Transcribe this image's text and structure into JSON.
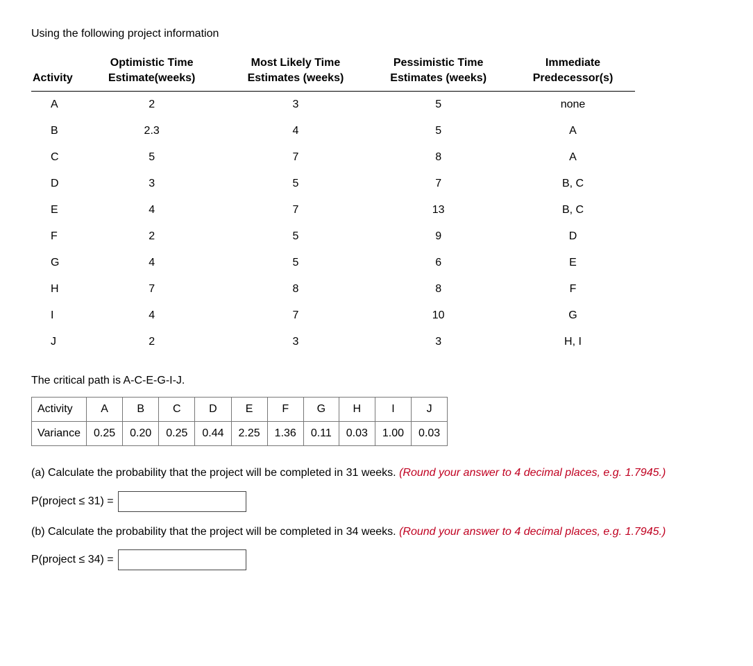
{
  "intro": "Using the following project information",
  "table_headers": {
    "activity": "Activity",
    "optimistic": "Optimistic Time Estimate(weeks)",
    "most_likely": "Most Likely Time Estimates (weeks)",
    "pessimistic": "Pessimistic Time Estimates (weeks)",
    "predecessor": "Immediate Predecessor(s)"
  },
  "rows": [
    {
      "act": "A",
      "opt": "2",
      "ml": "3",
      "pes": "5",
      "pred": "none"
    },
    {
      "act": "B",
      "opt": "2.3",
      "ml": "4",
      "pes": "5",
      "pred": "A"
    },
    {
      "act": "C",
      "opt": "5",
      "ml": "7",
      "pes": "8",
      "pred": "A"
    },
    {
      "act": "D",
      "opt": "3",
      "ml": "5",
      "pes": "7",
      "pred": "B, C"
    },
    {
      "act": "E",
      "opt": "4",
      "ml": "7",
      "pes": "13",
      "pred": "B, C"
    },
    {
      "act": "F",
      "opt": "2",
      "ml": "5",
      "pes": "9",
      "pred": "D"
    },
    {
      "act": "G",
      "opt": "4",
      "ml": "5",
      "pes": "6",
      "pred": "E"
    },
    {
      "act": "H",
      "opt": "7",
      "ml": "8",
      "pes": "8",
      "pred": "F"
    },
    {
      "act": "I",
      "opt": "4",
      "ml": "7",
      "pes": "10",
      "pred": "G"
    },
    {
      "act": "J",
      "opt": "2",
      "ml": "3",
      "pes": "3",
      "pred": "H, I"
    }
  ],
  "critical_path": "The critical path is A-C-E-G-I-J.",
  "variance_table": {
    "row_label_activity": "Activity",
    "row_label_variance": "Variance",
    "cols": [
      "A",
      "B",
      "C",
      "D",
      "E",
      "F",
      "G",
      "H",
      "I",
      "J"
    ],
    "vars": [
      "0.25",
      "0.20",
      "0.25",
      "0.44",
      "2.25",
      "1.36",
      "0.11",
      "0.03",
      "1.00",
      "0.03"
    ]
  },
  "question_a": {
    "text": "(a) Calculate the probability that the project will be completed in 31 weeks.",
    "hint": "(Round your answer to 4 decimal places, e.g. 1.7945.)",
    "label": "P(project ≤ 31) ="
  },
  "question_b": {
    "text": "(b) Calculate the probability that the project will be completed in 34 weeks.",
    "hint": "(Round your answer to 4 decimal places, e.g. 1.7945.)",
    "label": "P(project ≤ 34) ="
  }
}
